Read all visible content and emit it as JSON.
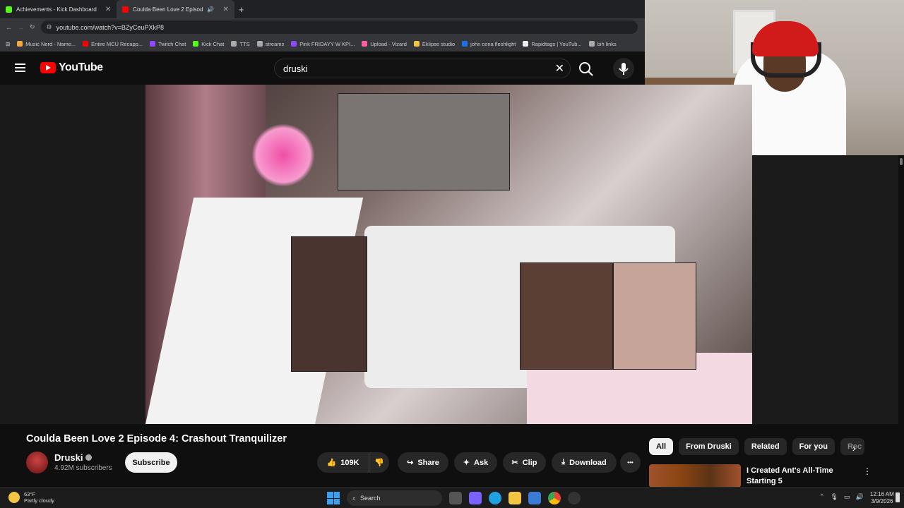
{
  "browser": {
    "tabs": [
      {
        "label": "Achievements - Kick Dashboard",
        "color": "#53fc18"
      },
      {
        "label": "Coulda Been Love 2 Episod",
        "color": "#ff0000"
      }
    ],
    "url": "youtube.com/watch?v=BZyCeuPXkP8",
    "bookmarks": [
      {
        "label": "Music Nerd - Name...",
        "color": "#f4a742"
      },
      {
        "label": "Entire MCU Recapp...",
        "color": "#ff0000"
      },
      {
        "label": "Twitch Chat",
        "color": "#9146ff"
      },
      {
        "label": "Kick Chat",
        "color": "#53fc18"
      },
      {
        "label": "TTS",
        "color": "#aaaaaa"
      },
      {
        "label": "streams",
        "color": "#aaaaaa"
      },
      {
        "label": "Pink FRIDAYY W KPI...",
        "color": "#9146ff"
      },
      {
        "label": "Upload - Vizard",
        "color": "#ff5ea3"
      },
      {
        "label": "Eklipse studio",
        "color": "#f4c542"
      },
      {
        "label": "john cena fleshlight",
        "color": "#1a73e8"
      },
      {
        "label": "Rapidtags | YouTub...",
        "color": "#eeeeee"
      },
      {
        "label": "bih links",
        "color": "#aaaaaa"
      }
    ]
  },
  "youtube": {
    "logo": "YouTube",
    "search_value": "druski",
    "video": {
      "title": "Coulda Been Love 2 Episode 4: Crashout Tranquilizer",
      "channel": "Druski",
      "subscribers": "4.92M subscribers",
      "subscribe_label": "Subscribe",
      "likes": "109K",
      "share_label": "Share",
      "ask_label": "Ask",
      "clip_label": "Clip",
      "download_label": "Download",
      "more_label": "•••"
    },
    "chips": [
      "All",
      "From Druski",
      "Related",
      "For you",
      "Rec"
    ],
    "recommendation": {
      "title": "I Created Ant's All-Time Starting 5"
    }
  },
  "taskbar": {
    "weather_temp": "63°F",
    "weather_desc": "Partly cloudy",
    "search_label": "Search",
    "time": "12:16 AM",
    "date": "3/9/2026"
  }
}
